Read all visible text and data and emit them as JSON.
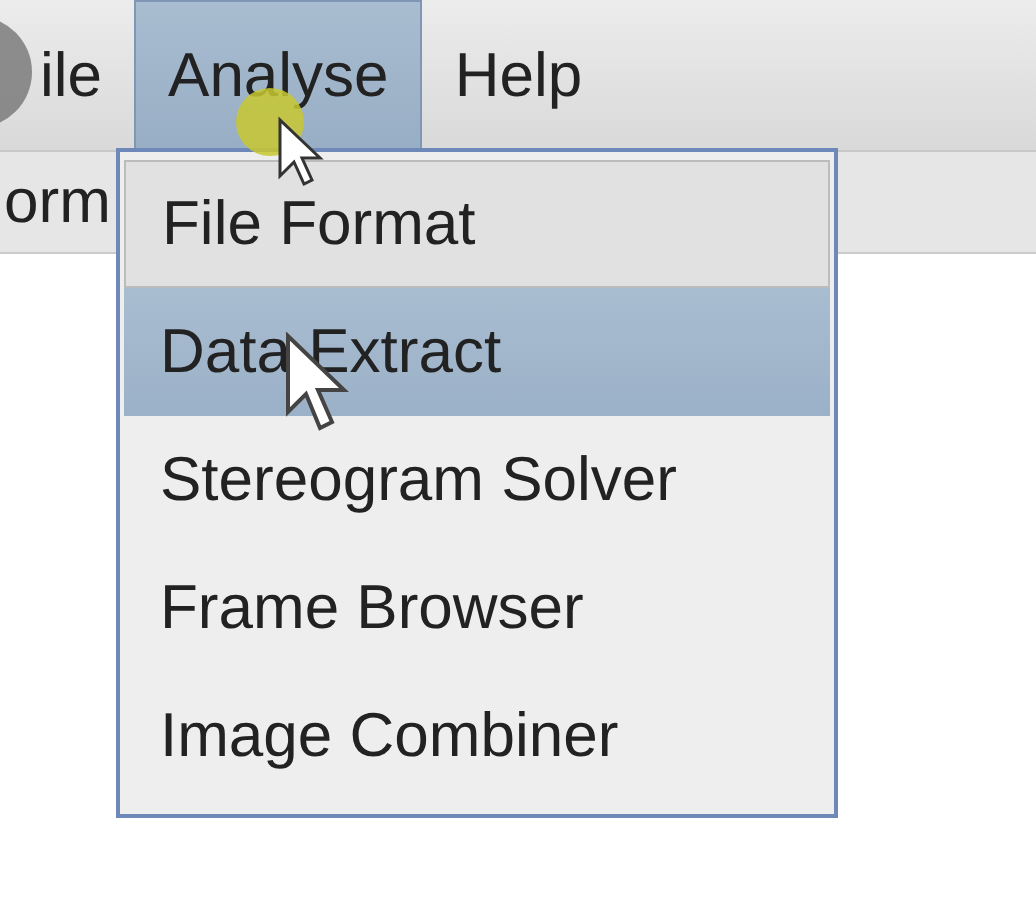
{
  "menu_bar": {
    "items": [
      {
        "label": "ile",
        "selected": false
      },
      {
        "label": "Analyse",
        "selected": true
      },
      {
        "label": "Help",
        "selected": false
      }
    ]
  },
  "window_row": {
    "label": "orm"
  },
  "dropdown": {
    "items": [
      {
        "label": "File Format",
        "selected": false
      },
      {
        "label": "Data Extract",
        "selected": true
      },
      {
        "label": "Stereogram Solver",
        "selected": false
      },
      {
        "label": "Frame Browser",
        "selected": false
      },
      {
        "label": "Image Combiner",
        "selected": false
      }
    ]
  }
}
